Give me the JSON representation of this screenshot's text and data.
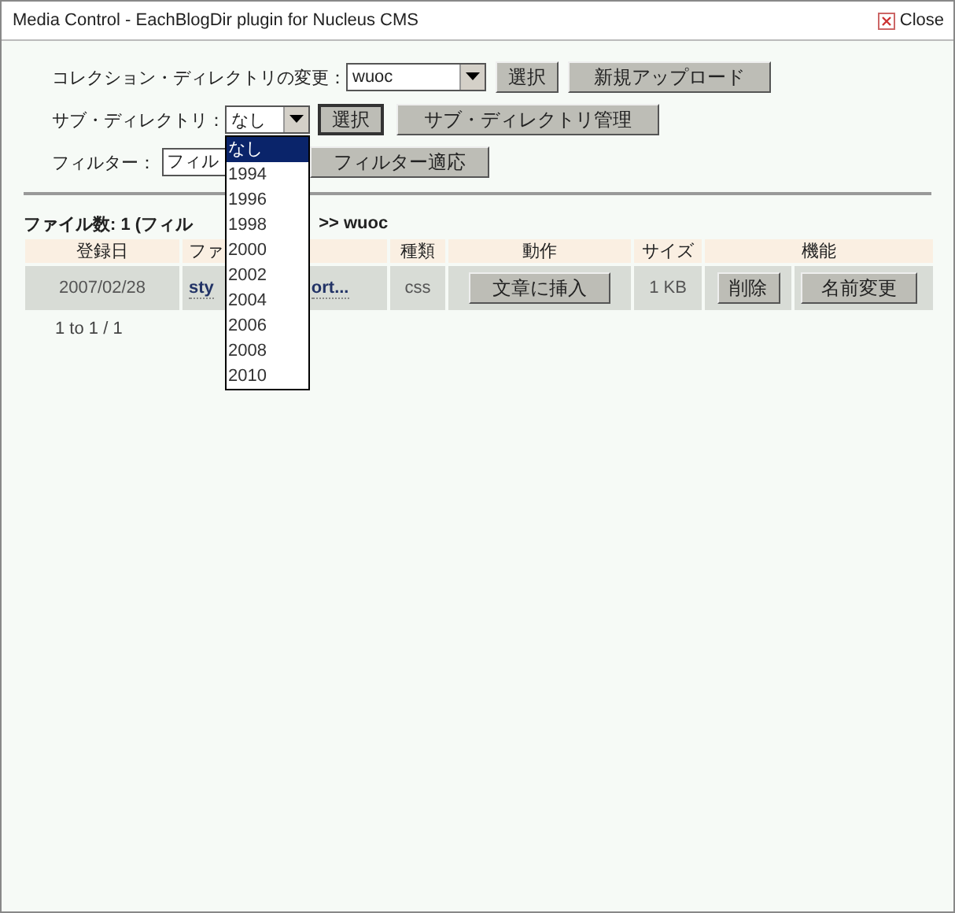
{
  "window": {
    "title": "Media Control - EachBlogDir plugin for Nucleus CMS",
    "close": "Close"
  },
  "collection": {
    "label": "コレクション・ディレクトリの変更：",
    "value": "wuoc",
    "buttons": [
      "選択",
      "新規アップロード"
    ]
  },
  "subdir": {
    "label": "サブ・ディレクトリ：",
    "value": "なし",
    "expanded": true,
    "options": [
      {
        "label": "なし",
        "selected": true
      },
      {
        "label": "1994",
        "selected": false
      },
      {
        "label": "1996",
        "selected": false
      },
      {
        "label": "1998",
        "selected": false
      },
      {
        "label": "2000",
        "selected": false
      },
      {
        "label": "2002",
        "selected": false
      },
      {
        "label": "2004",
        "selected": false
      },
      {
        "label": "2006",
        "selected": false
      },
      {
        "label": "2008",
        "selected": false
      },
      {
        "label": "2010",
        "selected": false
      }
    ],
    "buttons": [
      "選択",
      "サブ・ディレクトリ管理"
    ]
  },
  "filter": {
    "label": "フィルター：",
    "value": "フィル",
    "button": "フィルター適応"
  },
  "file_count": {
    "before": "ファイル数: 1 (フィル",
    "after": ">> wuoc"
  },
  "table": {
    "columns": [
      "登録日",
      "ファ",
      "種類",
      "動作",
      "サイズ",
      "機能"
    ],
    "rows": [
      {
        "date": "2007/02/28",
        "name_start": "sty",
        "name_end": "ort...",
        "type": "css",
        "insert": "文章に挿入",
        "size": "1 KB",
        "actions": [
          "削除",
          "名前変更"
        ]
      }
    ]
  },
  "pager": "1 to 1 / 1"
}
